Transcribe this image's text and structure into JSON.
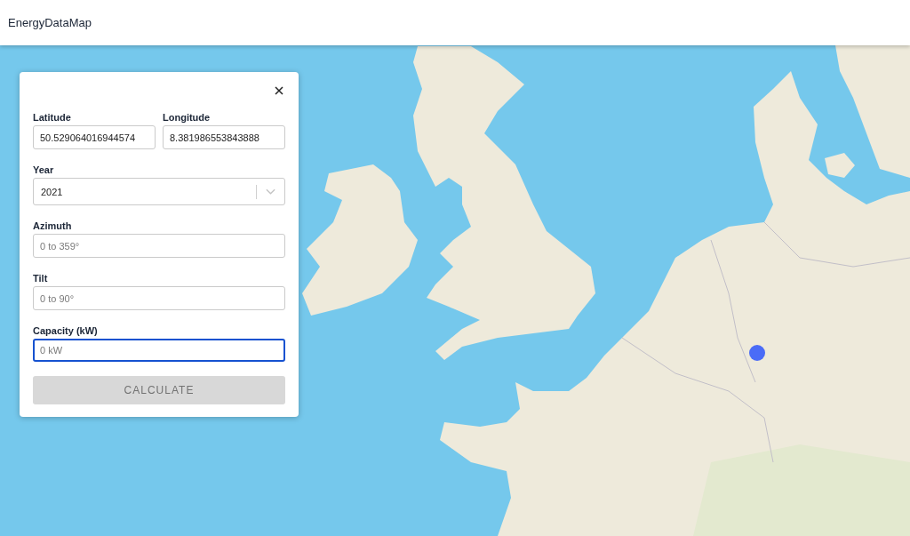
{
  "app_bar": {
    "title": "EnergyDataMap"
  },
  "panel": {
    "coordinates": [
      {
        "label": "Latitude",
        "value": "50.529064016944574",
        "focused": false
      },
      {
        "label": "Longitude",
        "value": "8.381986553843888",
        "focused": false
      }
    ],
    "fields": [
      {
        "kind": "select",
        "label": "Year",
        "value": "2021",
        "focused": false
      },
      {
        "kind": "text",
        "label": "Azimuth",
        "placeholder": "0 to 359°",
        "focused": false
      },
      {
        "kind": "text",
        "label": "Tilt",
        "placeholder": "0 to 90°",
        "focused": false
      },
      {
        "kind": "text",
        "label": "Capacity (kW)",
        "placeholder": "0 kW",
        "focused": true
      }
    ],
    "submit": {
      "label": "CALCULATE",
      "disabled": true
    }
  }
}
